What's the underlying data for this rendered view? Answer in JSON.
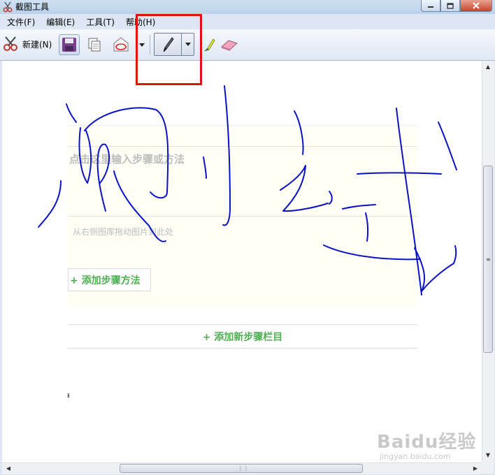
{
  "window": {
    "title": "截图工具",
    "controls": {
      "minimize": "minimize-icon",
      "maximize": "maximize-icon",
      "close": "close-icon"
    }
  },
  "menu": [
    {
      "label": "文件(F)"
    },
    {
      "label": "编辑(E)"
    },
    {
      "label": "工具(T)"
    },
    {
      "label": "帮助(H)"
    }
  ],
  "toolbar": {
    "new_label": "新建(N)",
    "buttons": [
      "scissors-icon",
      "save-icon",
      "copy-icon",
      "send-email-icon",
      "pen-icon",
      "highlighter-icon",
      "eraser-icon"
    ]
  },
  "editor": {
    "step_placeholder": "点击这里输入步骤或方法",
    "drag_hint": "从右侧图库拖动图片到此处",
    "add_step": "+ 添加步骤方法",
    "add_column": "+ 添加新步骤栏目",
    "mark": "ᵻ"
  },
  "watermark": {
    "brand": "Baidu经验",
    "url": "jingyan.baidu.com"
  },
  "colors": {
    "ink": "#0a12c8",
    "highlight_box": "#e0140e",
    "accent_green": "#4caf50"
  }
}
